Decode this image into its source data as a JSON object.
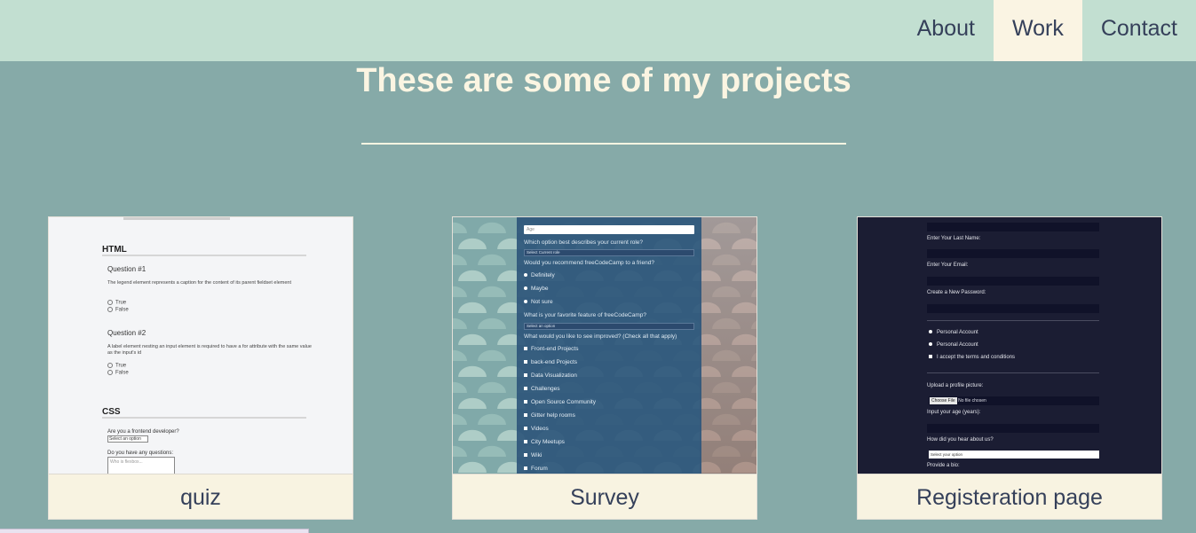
{
  "nav": {
    "items": [
      {
        "label": "About"
      },
      {
        "label": "Work"
      },
      {
        "label": "Contact"
      }
    ],
    "active": "Work"
  },
  "projects": {
    "heading": "These are some of my projects",
    "cards": [
      {
        "caption": "quiz",
        "preview": {
          "section1": "HTML",
          "q1_title": "Question #1",
          "q1_text": "The legend element represents a caption for the content of its parent fieldset element",
          "q1_opt1": "True",
          "q1_opt2": "False",
          "q2_title": "Question #2",
          "q2_text": "A label element nesting an input element is required to have a for attribute with the same value as the input's id",
          "q2_opt1": "True",
          "q2_opt2": "False",
          "section2": "CSS",
          "q3_text": "Are you a frontend developer?",
          "q3_select": "Select an option",
          "q4_text": "Do you have any questions:",
          "q4_placeholder": "Who is flexbox..."
        }
      },
      {
        "caption": "Survey",
        "preview": {
          "age_placeholder": "Age",
          "role_q": "Which option best describes your current role?",
          "role_select": "Select Current role",
          "recommend_q": "Would you recommend freeCodeCamp to a friend?",
          "recommend_opts": [
            "Definitely",
            "Maybe",
            "Not sure"
          ],
          "feature_q": "What is your favorite feature of freeCodeCamp?",
          "feature_select": "Select an option",
          "improve_q": "What would you like to see improved? (Check all that apply)",
          "improve_opts": [
            "Front-end Projects",
            "back-end Projects",
            "Data Visualization",
            "Challenges",
            "Open Source Community",
            "Gitter help rooms",
            "Videos",
            "City Meetups",
            "Wiki",
            "Forum"
          ]
        }
      },
      {
        "caption": "Registeration page",
        "preview": {
          "last_name": "Enter Your Last Name:",
          "email": "Enter Your Email:",
          "password": "Create a New Password:",
          "account1": "Personal Account",
          "account2": "Personal Account",
          "terms": "I accept the terms and conditions",
          "upload": "Upload a profile picture:",
          "choose_file": "Choose File",
          "no_file": "No file chosen",
          "age": "Input your age (years):",
          "hear": "How did you hear about us?",
          "hear_select": "Select your option",
          "bio": "Provide a bio:"
        }
      }
    ]
  },
  "colors": {
    "page_bg": "#86aaa8",
    "navbar_bg": "#c2dfd1",
    "active_nav_bg": "#faf4e3",
    "caption_bg": "#f8f3e1",
    "text_dark": "#35405a",
    "heading_text": "#fbf5e2"
  }
}
